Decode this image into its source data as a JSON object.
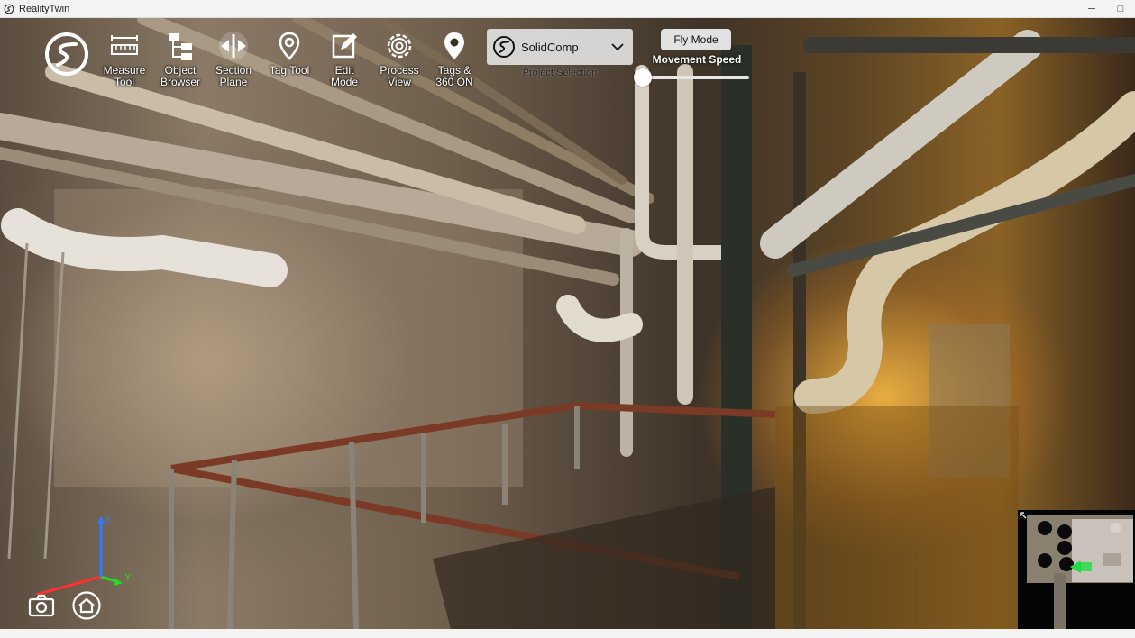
{
  "window": {
    "title": "RealityTwin",
    "controls": {
      "minimize": "─",
      "maximize": "□"
    }
  },
  "toolbar": {
    "logo": "solidcomp-logo-icon",
    "buttons": [
      {
        "id": "measure",
        "line1": "Measure",
        "line2": "Tool",
        "icon": "ruler-icon"
      },
      {
        "id": "object",
        "line1": "Object",
        "line2": "Browser",
        "icon": "hierarchy-icon"
      },
      {
        "id": "section",
        "line1": "Section",
        "line2": "Plane",
        "icon": "section-plane-icon"
      },
      {
        "id": "tag",
        "line1": "Tag Tool",
        "line2": "",
        "icon": "map-pin-icon"
      },
      {
        "id": "edit",
        "line1": "Edit",
        "line2": "Mode",
        "icon": "edit-icon"
      },
      {
        "id": "process",
        "line1": "Process",
        "line2": "View",
        "icon": "gear-icon"
      },
      {
        "id": "tags360",
        "line1": "Tags &",
        "line2": "360 ON",
        "icon": "pin-360-icon"
      }
    ]
  },
  "project": {
    "selected": "SolidComp",
    "caption": "Project Selection"
  },
  "movement": {
    "fly_mode_label": "Fly Mode",
    "speed_label": "Movement Speed",
    "speed_value": 0.0
  },
  "axes": {
    "z": "Z",
    "y": "Y",
    "colors": {
      "z": "#2f7bff",
      "y": "#22dd22",
      "x": "#ff3030"
    }
  },
  "bottom_controls": {
    "camera": "camera-icon",
    "home": "home-icon"
  },
  "minimap": {
    "marker_color": "#22dd44"
  }
}
